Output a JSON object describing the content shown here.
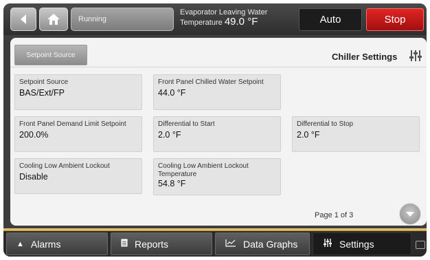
{
  "topbar": {
    "status": "Running",
    "evap_label_line1": "Evaporator Leaving Water",
    "evap_label_line2": "Temperature",
    "evap_value": "49.0 °F",
    "auto_label": "Auto",
    "stop_label": "Stop",
    "stop_color": "#c4161c"
  },
  "content": {
    "setpoint_source_button": "Setpoint Source",
    "title": "Chiller Settings",
    "cards": [
      {
        "label": "Setpoint Source",
        "value": "BAS/Ext/FP"
      },
      {
        "label": "Front Panel Chilled Water Setpoint",
        "value": "44.0 °F"
      },
      {
        "label": "Front Panel Demand Limit Setpoint",
        "value": "200.0%"
      },
      {
        "label": "Differential to Start",
        "value": "2.0 °F"
      },
      {
        "label": "Differential to Stop",
        "value": "2.0 °F"
      },
      {
        "label": "Cooling Low Ambient Lockout",
        "value": "Disable"
      },
      {
        "label": "Cooling Low Ambient Lockout Temperature",
        "value": "54.8 °F"
      }
    ],
    "pager": "Page 1 of 3"
  },
  "nav": {
    "alarms": "Alarms",
    "reports": "Reports",
    "data_graphs": "Data Graphs",
    "settings": "Settings"
  },
  "icons": {
    "back": "back-arrow-icon",
    "home": "home-icon",
    "settings": "sliders-icon",
    "scroll": "chevron-down-icon",
    "chat": "chat-icon"
  }
}
